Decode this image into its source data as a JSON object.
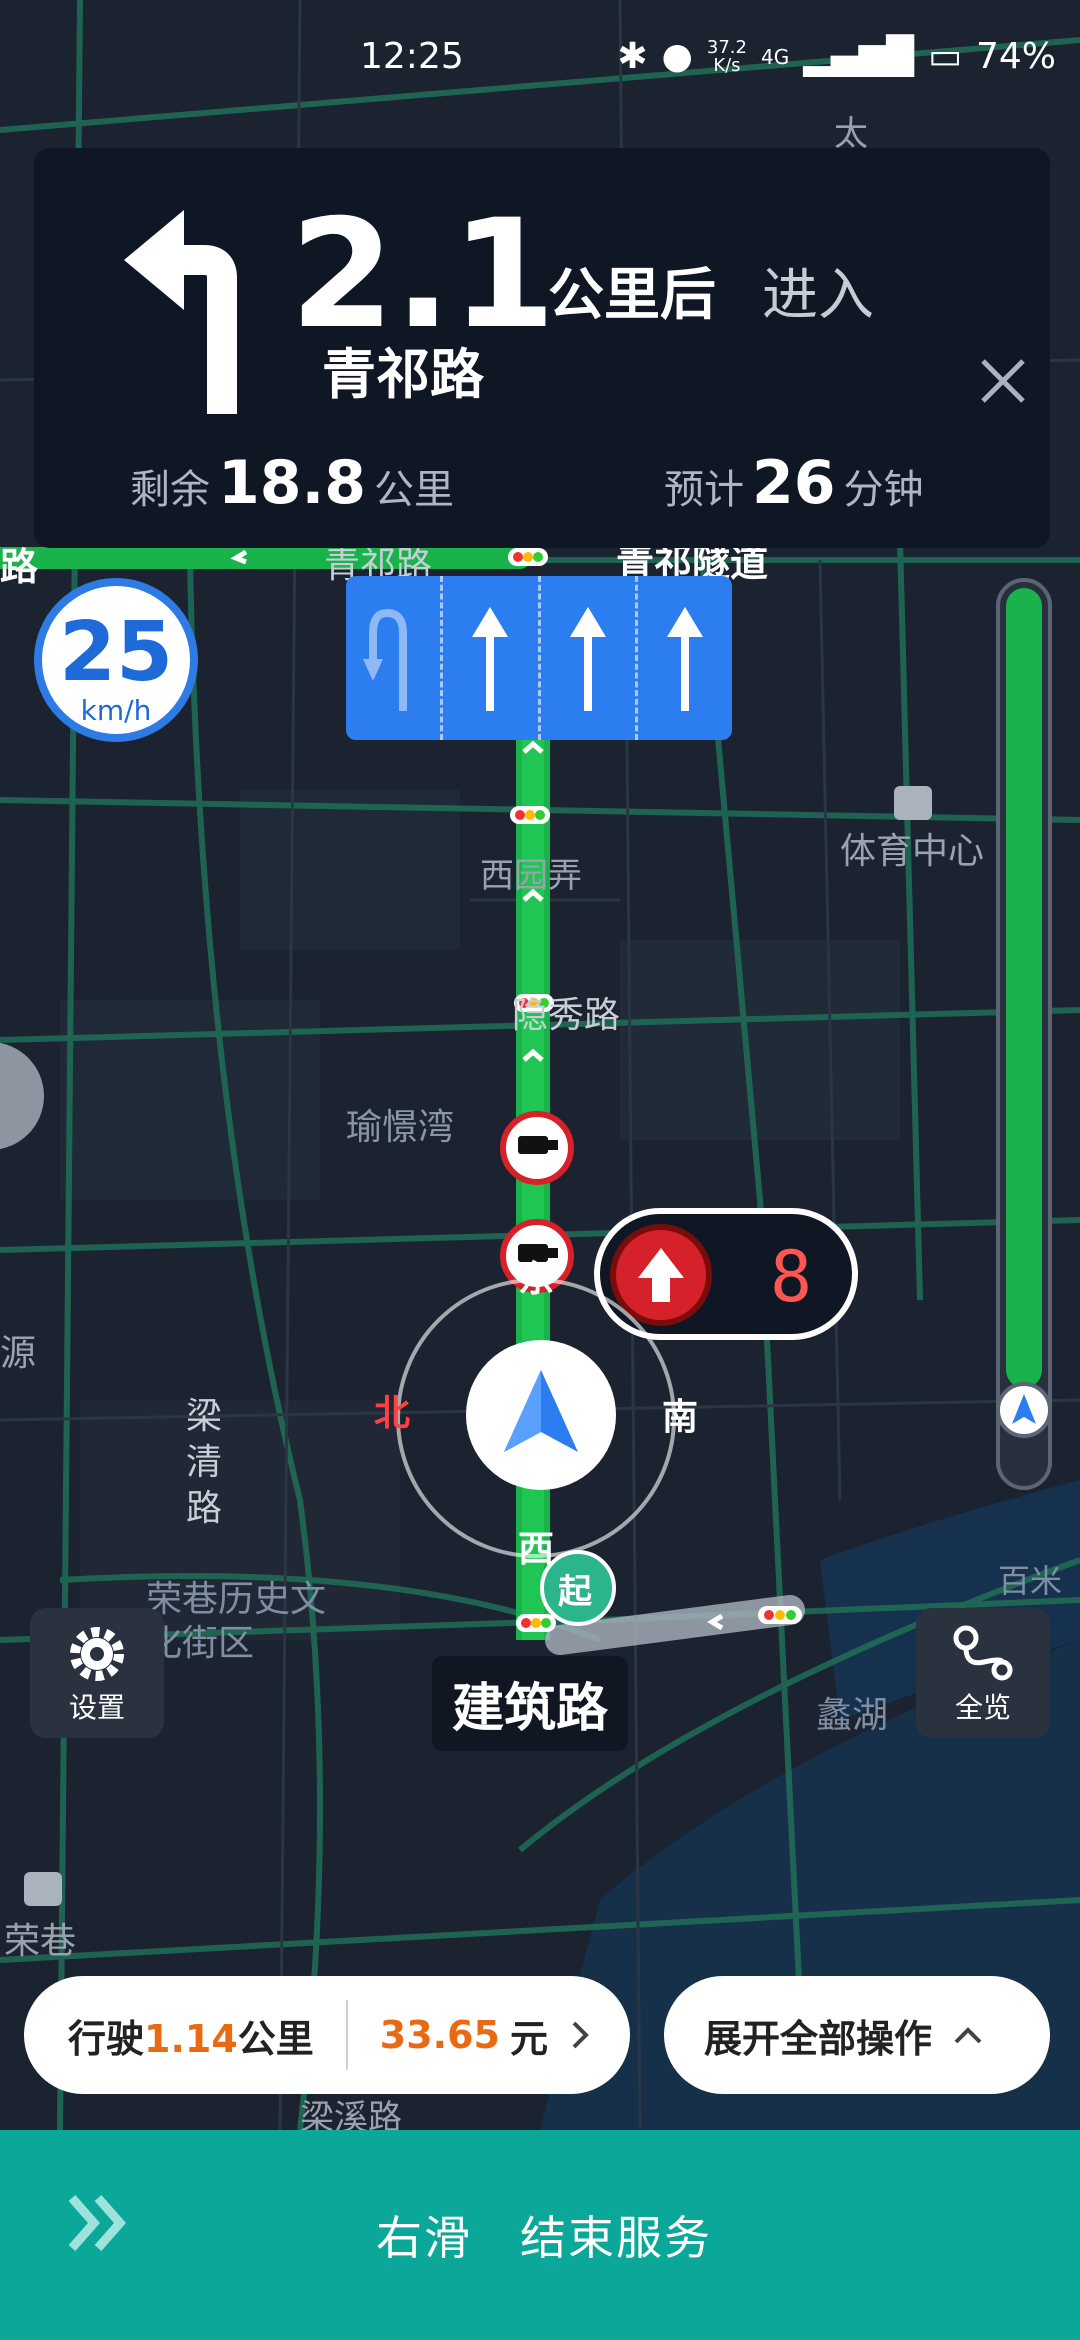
{
  "status_bar": {
    "time": "12:25",
    "net_speed": "37.2",
    "net_unit": "K/s",
    "network": "4G",
    "battery": "74%"
  },
  "guidance": {
    "distance": "2.1",
    "distance_unit": "公里后",
    "action": "进入",
    "road": "青祁路",
    "remaining_prefix": "剩余",
    "remaining_value": "18.8",
    "remaining_unit": "公里",
    "eta_prefix": "预计",
    "eta_value": "26",
    "eta_unit": "分钟"
  },
  "speed_limit": {
    "value": "25",
    "unit": "km/h"
  },
  "lanes": [
    "uturn-left",
    "straight",
    "straight",
    "straight"
  ],
  "traffic_light": {
    "countdown": "8"
  },
  "compass": {
    "east": "东",
    "west": "西",
    "north": "北",
    "south": "南"
  },
  "map_labels": {
    "qingqi_road": "青祁路",
    "qingqi_tunnel": "青祁隧道",
    "xiyuannong": "西园弄",
    "yinxiu_road": "隐秀路",
    "yuhuiwan": "瑜憬湾",
    "sports_center": "体育中心",
    "liangqing_road": "梁清路",
    "rongxiang_street": "荣巷历史文化街区",
    "lihu": "蠡湖",
    "baimi": "百米",
    "rongxiang": "荣巷",
    "liangyuan_road": "梁溪路",
    "start_marker": "起",
    "yuan": "源",
    "tai": "太",
    "road_left": "路"
  },
  "current_road": "建筑路",
  "buttons": {
    "settings": "设置",
    "overview": "全览"
  },
  "trip": {
    "drive_prefix": "行驶",
    "drive_value": "1.14",
    "drive_unit": "公里",
    "fare": "33.65",
    "fare_unit": "元",
    "expand_label": "展开全部操作"
  },
  "swipe": {
    "label": "右滑　结束服务"
  },
  "colors": {
    "route_green": "#19b24b",
    "lane_blue": "#2c7ef0",
    "accent_orange": "#e96a14",
    "swipe_bar": "#0ba89a"
  }
}
